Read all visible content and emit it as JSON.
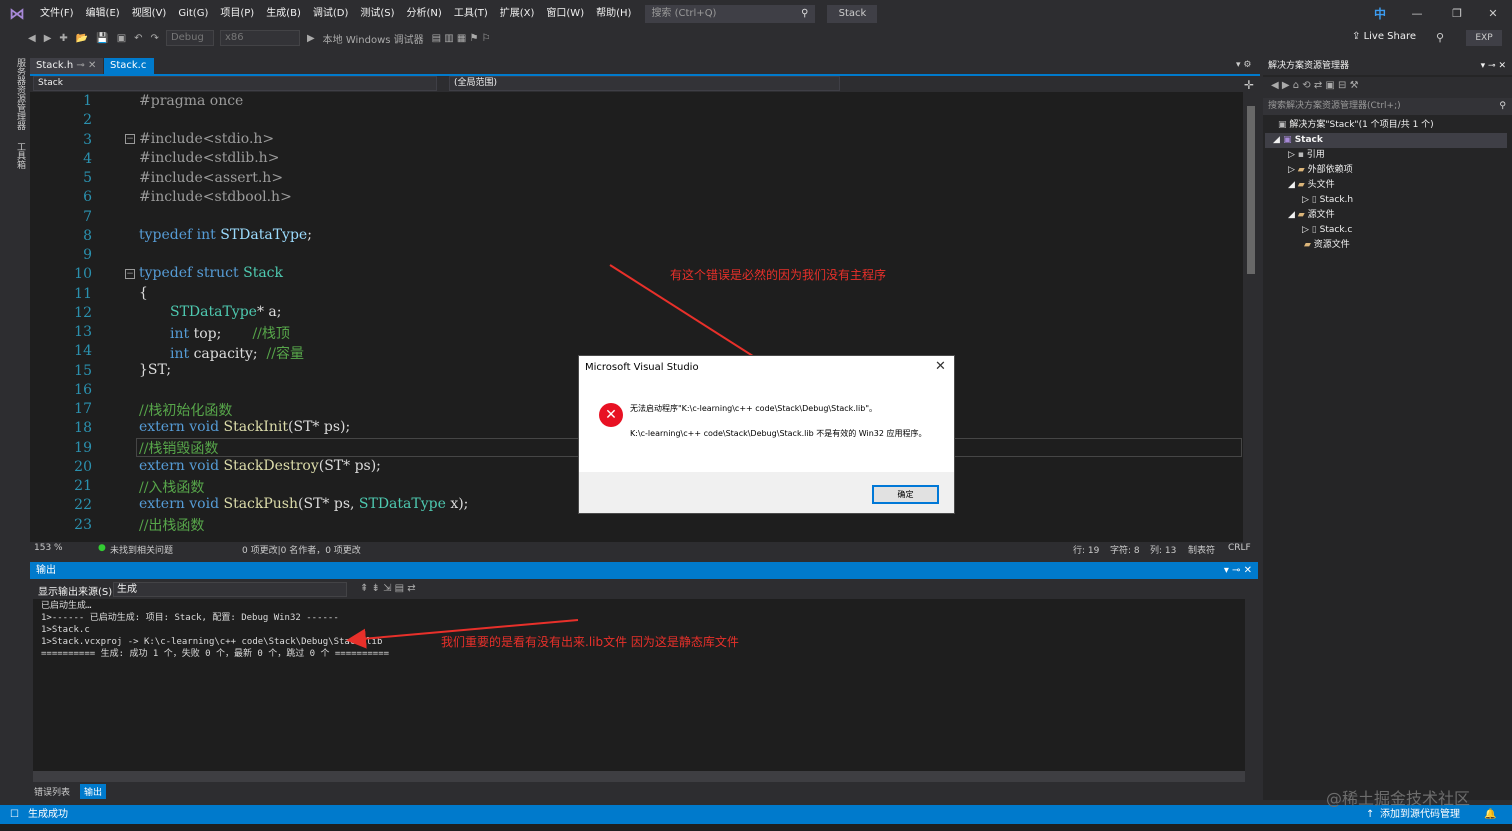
{
  "menu": [
    "文件(F)",
    "编辑(E)",
    "视图(V)",
    "Git(G)",
    "项目(P)",
    "生成(B)",
    "调试(D)",
    "测试(S)",
    "分析(N)",
    "工具(T)",
    "扩展(X)",
    "窗口(W)",
    "帮助(H)"
  ],
  "search": {
    "placeholder": "搜索 (Ctrl+Q)"
  },
  "window_title": "Stack",
  "ime": "中",
  "toolbar": {
    "config": "Debug",
    "platform": "x86",
    "debugger": "本地 Windows 调试器",
    "live_share": "Live Share",
    "exp": "EXP"
  },
  "left_sidebar": {
    "tab1": "服务器资源管理器",
    "tab2": "工具箱"
  },
  "tabs": [
    {
      "label": "Stack.h"
    },
    {
      "label": "Stack.c"
    }
  ],
  "nav": {
    "project": "Stack",
    "scope": "(全局范围)"
  },
  "line_numbers": [
    "1",
    "2",
    "3",
    "4",
    "5",
    "6",
    "7",
    "8",
    "9",
    "10",
    "11",
    "12",
    "13",
    "14",
    "15",
    "16",
    "17",
    "18",
    "19",
    "20",
    "21",
    "22",
    "23"
  ],
  "code": {
    "l1": "#pragma once",
    "l3": "#include<stdio.h>",
    "l4": "#include<stdlib.h>",
    "l5": "#include<assert.h>",
    "l6": "#include<stdbool.h>",
    "l8_kw": "typedef int ",
    "l8_id": "STDataType",
    "l8_end": ";",
    "l10_kw": "typedef struct ",
    "l10_id": "Stack",
    "l11": "{",
    "l12_ty": "STDataType",
    "l12_rest": "* a;",
    "l13_kw": "int ",
    "l13_rest": "top;       ",
    "l13_cm": "//栈顶",
    "l14_kw": "int ",
    "l14_rest": "capacity;  ",
    "l14_cm": "//容量",
    "l15": "}ST;",
    "l17": "//栈初始化函数",
    "l18_kw": "extern void ",
    "l18_fn": "StackInit",
    "l18_rest": "(ST* ps);",
    "l19": "//栈销毁函数",
    "l20_kw": "extern void ",
    "l20_fn": "StackDestroy",
    "l20_rest": "(ST* ps);",
    "l21": "//入栈函数",
    "l22_kw": "extern void ",
    "l22_fn": "StackPush",
    "l22_rest": "(ST* ps, ",
    "l22_ty": "STDataType",
    "l22_end": " x);",
    "l23": "//出栈函数"
  },
  "editor_status": {
    "zoom": "153 %",
    "issues": "未找到相关问题",
    "changes": "0 项更改|0 名作者，0 项更改",
    "row": "行: 19",
    "char": "字符: 8",
    "col": "列: 13",
    "tab": "制表符",
    "eol": "CRLF"
  },
  "output": {
    "title": "输出",
    "source_label": "显示输出来源(S):",
    "source_value": "生成",
    "lines": [
      "已启动生成…",
      "1>------ 已启动生成: 项目: Stack, 配置: Debug Win32 ------",
      "1>Stack.c",
      "1>Stack.vcxproj -> K:\\c-learning\\c++ code\\Stack\\Debug\\Stack.lib",
      "========== 生成: 成功 1 个，失败 0 个，最新 0 个，跳过 0 个 =========="
    ]
  },
  "bottom_tabs": [
    "错误列表",
    "输出"
  ],
  "solution_explorer": {
    "title": "解决方案资源管理器",
    "search_placeholder": "搜索解决方案资源管理器(Ctrl+;)",
    "items": [
      "解决方案\"Stack\"(1 个项目/共 1 个)",
      "Stack",
      "引用",
      "外部依赖项",
      "头文件",
      "Stack.h",
      "源文件",
      "Stack.c",
      "资源文件"
    ]
  },
  "statusbar": {
    "left": "生成成功",
    "right": "添加到源代码管理"
  },
  "dialog": {
    "title": "Microsoft Visual Studio",
    "message1": "无法启动程序\"K:\\c-learning\\c++ code\\Stack\\Debug\\Stack.lib\"。",
    "message2": "K:\\c-learning\\c++ code\\Stack\\Debug\\Stack.lib 不是有效的 Win32 应用程序。",
    "ok": "确定"
  },
  "annotations": {
    "top": "有这个错误是必然的因为我们没有主程序",
    "bottom": "我们重要的是看有没有出来.lib文件  因为这是静态库文件"
  },
  "watermark": "@稀土掘金技术社区",
  "colors": {
    "accent": "#007acc",
    "editor_bg": "#1e1e1e",
    "annotation": "#e8302a",
    "error": "#e81123"
  }
}
